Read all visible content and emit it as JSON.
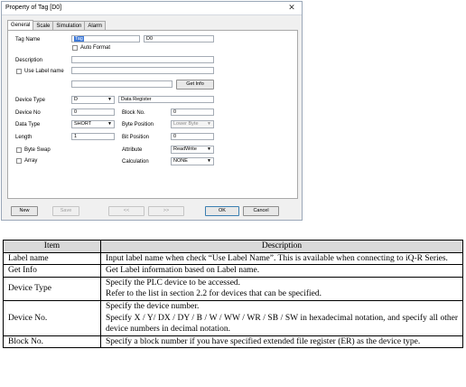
{
  "dialog": {
    "title": "Property of Tag [D0]",
    "tabs": [
      "General",
      "Scale",
      "Simulation",
      "Alarm"
    ],
    "tag_name_label": "Tag Name",
    "tag_name_value": "Tag",
    "tag_name_device": "D0",
    "auto_format_label": "Auto Format",
    "description_label": "Description",
    "description_value": "",
    "use_label_name_label": "Use Label name",
    "label_name_value": "",
    "get_info_label": "Get Info",
    "device_type_label": "Device Type",
    "device_type_value": "D",
    "device_type_desc": "Data Register",
    "device_no_label": "Device No",
    "device_no_value": "0",
    "block_no_label": "Block No.",
    "block_no_value": "0",
    "data_type_label": "Data Type",
    "data_type_value": "SHORT",
    "byte_position_label": "Byte Position",
    "byte_position_value": "Lower Byte",
    "length_label": "Length",
    "length_value": "1",
    "bit_position_label": "Bit Position",
    "bit_position_value": "0",
    "byte_swap_label": "Byte Swap",
    "array_label": "Array",
    "attribute_label": "Attribute",
    "attribute_value": "ReadWrite",
    "calculation_label": "Calculation",
    "calculation_value": "NONE",
    "buttons": {
      "new": "New",
      "save": "Save",
      "prev": "<<",
      "next": ">>",
      "ok": "OK",
      "cancel": "Cancel"
    },
    "close_glyph": "✕"
  },
  "table": {
    "headers": [
      "Item",
      "Description"
    ],
    "rows": [
      {
        "item": "Label name",
        "lines": [
          "Input label name when check “Use Label Name”. This is available when connecting to iQ-R Series."
        ]
      },
      {
        "item": "Get Info",
        "lines": [
          "Get Label information based on Label name."
        ]
      },
      {
        "item": "Device Type",
        "lines": [
          "Specify the PLC device to be accessed.",
          "Refer to the list in section 2.2 for devices that can be specified."
        ]
      },
      {
        "item": "Device No.",
        "lines": [
          "Specify the device number.",
          "Specify X / Y/ DX / DY / B / W / WW / WR / SB / SW in hexadecimal notation, and specify all other device numbers in decimal notation."
        ]
      },
      {
        "item": "Block No.",
        "lines": [
          "Specify a block number if you have specified extended file register (ER) as the device type."
        ]
      }
    ]
  }
}
